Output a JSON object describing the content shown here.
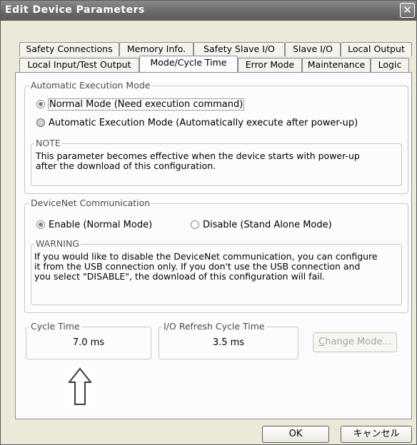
{
  "window": {
    "title": "Edit Device Parameters",
    "close_glyph": "✕"
  },
  "tabs_row1": [
    "Safety Connections",
    "Memory Info.",
    "Safety Slave I/O",
    "Slave I/O",
    "Local Output"
  ],
  "tabs_row2": [
    "Local Input/Test Output",
    "Mode/Cycle Time",
    "Error Mode",
    "Maintenance",
    "Logic"
  ],
  "active_tab": "Mode/Cycle Time",
  "auto_exec": {
    "legend": "Automatic Execution Mode",
    "option_normal": "Normal Mode (Need execution command)",
    "option_auto": "Automatic Execution Mode (Automatically execute after power-up)",
    "selected": "option_normal",
    "note_legend": "NOTE",
    "note_line1": "This parameter becomes effective when the device starts with power-up",
    "note_line2": "after the download of this configuration."
  },
  "devicenet": {
    "legend": "DeviceNet Communication",
    "option_enable": "Enable (Normal Mode)",
    "option_disable": "Disable (Stand Alone Mode)",
    "selected": "option_enable",
    "warning_legend": "WARNING",
    "warning_line1": "If you would like to disable the DeviceNet communication, you can configure",
    "warning_line2": "it from the USB connection only. If you don't use the USB connection and",
    "warning_line3": "you select \"DISABLE\", the download of this configuration will fail."
  },
  "cycle_time": {
    "legend": "Cycle Time",
    "value": "7.0 ms"
  },
  "io_refresh": {
    "legend": "I/O Refresh Cycle Time",
    "value": "3.5 ms"
  },
  "change_mode_button": {
    "label_accel": "C",
    "label_rest": "hange Mode..."
  },
  "annotation_arrow": "up-arrow-icon",
  "footer": {
    "ok": "OK",
    "cancel": "キャンセル"
  }
}
